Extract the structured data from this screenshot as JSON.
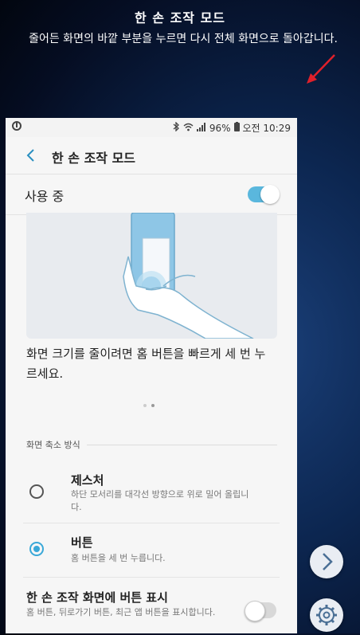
{
  "overlay": {
    "title": "한 손 조작 모드",
    "description": "줄어든 화면의 바깥 부분을 누르면 다시 전체 화면으로 돌아갑니다."
  },
  "status_bar": {
    "battery": "96%",
    "time": "오전 10:29"
  },
  "app_bar": {
    "title": "한 손 조작 모드"
  },
  "master_toggle": {
    "label": "사용 중",
    "on": true
  },
  "help_text": "화면 크기를 줄이려면 홈 버튼을 빠르게 세 번 누르세요.",
  "pager": {
    "count": 2,
    "active": 1
  },
  "section": {
    "header": "화면 축소 방식",
    "options": [
      {
        "title": "제스처",
        "description": "하단 모서리를 대각선 방향으로 위로 밀어 올립니다.",
        "selected": false
      },
      {
        "title": "버튼",
        "description": "홈 버튼을 세 번 누릅니다.",
        "selected": true
      }
    ]
  },
  "show_buttons": {
    "title": "한 손 조작 화면에 버튼 표시",
    "description": "홈 버튼, 뒤로가기 버튼, 최근 앱 버튼을 표시합니다.",
    "on": false
  },
  "colors": {
    "accent": "#3aa8d8",
    "toggle_on": "#5ab7dd",
    "arrow": "#e0202a"
  }
}
